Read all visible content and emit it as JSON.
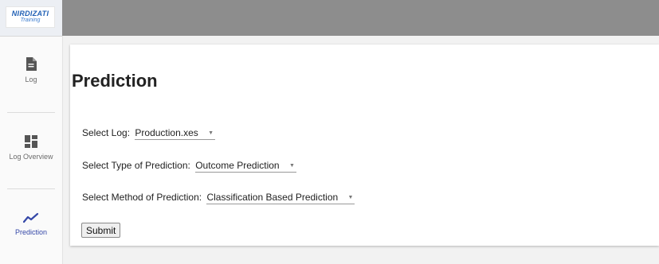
{
  "logo": {
    "main": "NIRDIZATI",
    "sub": "Training"
  },
  "sidebar": {
    "items": [
      {
        "label": "Log",
        "icon": "document-icon"
      },
      {
        "label": "Log Overview",
        "icon": "dashboard-icon"
      },
      {
        "label": "Prediction",
        "icon": "trending-line-icon",
        "active": true
      }
    ]
  },
  "main": {
    "title": "Prediction",
    "form": {
      "log_label": "Select Log:",
      "log_value": "Production.xes",
      "type_label": "Select Type of Prediction:",
      "type_value": "Outcome Prediction",
      "method_label": "Select Method of Prediction:",
      "method_value": "Classification Based Prediction",
      "submit_label": "Submit"
    }
  },
  "colors": {
    "accent": "#3548a8",
    "topbar": "#8d8d8d",
    "logo_blue": "#1f5fb4"
  }
}
